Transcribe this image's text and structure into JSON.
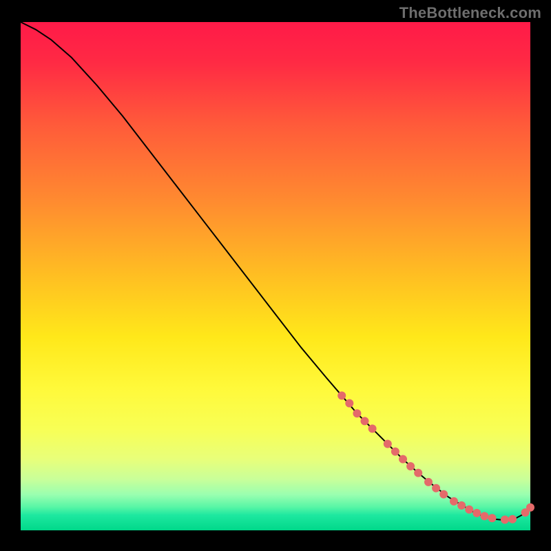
{
  "watermark": "TheBottleneck.com",
  "chart_data": {
    "type": "line",
    "title": "",
    "xlabel": "",
    "ylabel": "",
    "xlim": [
      0,
      100
    ],
    "ylim": [
      0,
      100
    ],
    "grid": false,
    "legend": false,
    "background_gradient_stops": [
      {
        "offset": 0.0,
        "color": "#ff1a48"
      },
      {
        "offset": 0.08,
        "color": "#ff2a44"
      },
      {
        "offset": 0.2,
        "color": "#ff5a3a"
      },
      {
        "offset": 0.35,
        "color": "#ff8a30"
      },
      {
        "offset": 0.5,
        "color": "#ffbf22"
      },
      {
        "offset": 0.62,
        "color": "#ffe81a"
      },
      {
        "offset": 0.72,
        "color": "#fff93a"
      },
      {
        "offset": 0.8,
        "color": "#f8ff55"
      },
      {
        "offset": 0.86,
        "color": "#e8ff7a"
      },
      {
        "offset": 0.9,
        "color": "#c8ff9a"
      },
      {
        "offset": 0.93,
        "color": "#99ffb0"
      },
      {
        "offset": 0.955,
        "color": "#55f5a5"
      },
      {
        "offset": 0.97,
        "color": "#1ee8a0"
      },
      {
        "offset": 1.0,
        "color": "#00d88a"
      }
    ],
    "series": [
      {
        "name": "bottleneck-curve",
        "color": "#000000",
        "width": 2,
        "x": [
          0,
          3,
          6,
          10,
          15,
          20,
          25,
          30,
          35,
          40,
          45,
          50,
          55,
          60,
          63,
          66,
          69,
          72,
          75,
          78,
          81,
          84,
          87,
          89,
          91,
          93,
          95,
          97,
          98.5,
          100
        ],
        "y": [
          100,
          98.5,
          96.5,
          93,
          87.5,
          81.5,
          75,
          68.5,
          62,
          55.5,
          49,
          42.5,
          36,
          30,
          26.5,
          23,
          20,
          17,
          14,
          11.3,
          8.8,
          6.5,
          4.7,
          3.5,
          2.7,
          2.2,
          2.0,
          2.3,
          3.1,
          4.5
        ]
      }
    ],
    "markers": {
      "name": "highlight-points",
      "color": "#e46a6a",
      "radius": 6,
      "points": [
        {
          "x": 63.0,
          "y": 26.5
        },
        {
          "x": 64.5,
          "y": 25.0
        },
        {
          "x": 66.0,
          "y": 23.0
        },
        {
          "x": 67.5,
          "y": 21.5
        },
        {
          "x": 69.0,
          "y": 20.0
        },
        {
          "x": 72.0,
          "y": 17.0
        },
        {
          "x": 73.5,
          "y": 15.5
        },
        {
          "x": 75.0,
          "y": 14.0
        },
        {
          "x": 76.5,
          "y": 12.6
        },
        {
          "x": 78.0,
          "y": 11.3
        },
        {
          "x": 80.0,
          "y": 9.5
        },
        {
          "x": 81.5,
          "y": 8.3
        },
        {
          "x": 83.0,
          "y": 7.1
        },
        {
          "x": 85.0,
          "y": 5.7
        },
        {
          "x": 86.5,
          "y": 4.9
        },
        {
          "x": 88.0,
          "y": 4.1
        },
        {
          "x": 89.5,
          "y": 3.4
        },
        {
          "x": 91.0,
          "y": 2.8
        },
        {
          "x": 92.5,
          "y": 2.4
        },
        {
          "x": 95.0,
          "y": 2.1
        },
        {
          "x": 96.5,
          "y": 2.2
        },
        {
          "x": 99.0,
          "y": 3.5
        },
        {
          "x": 100.0,
          "y": 4.5
        }
      ]
    }
  }
}
